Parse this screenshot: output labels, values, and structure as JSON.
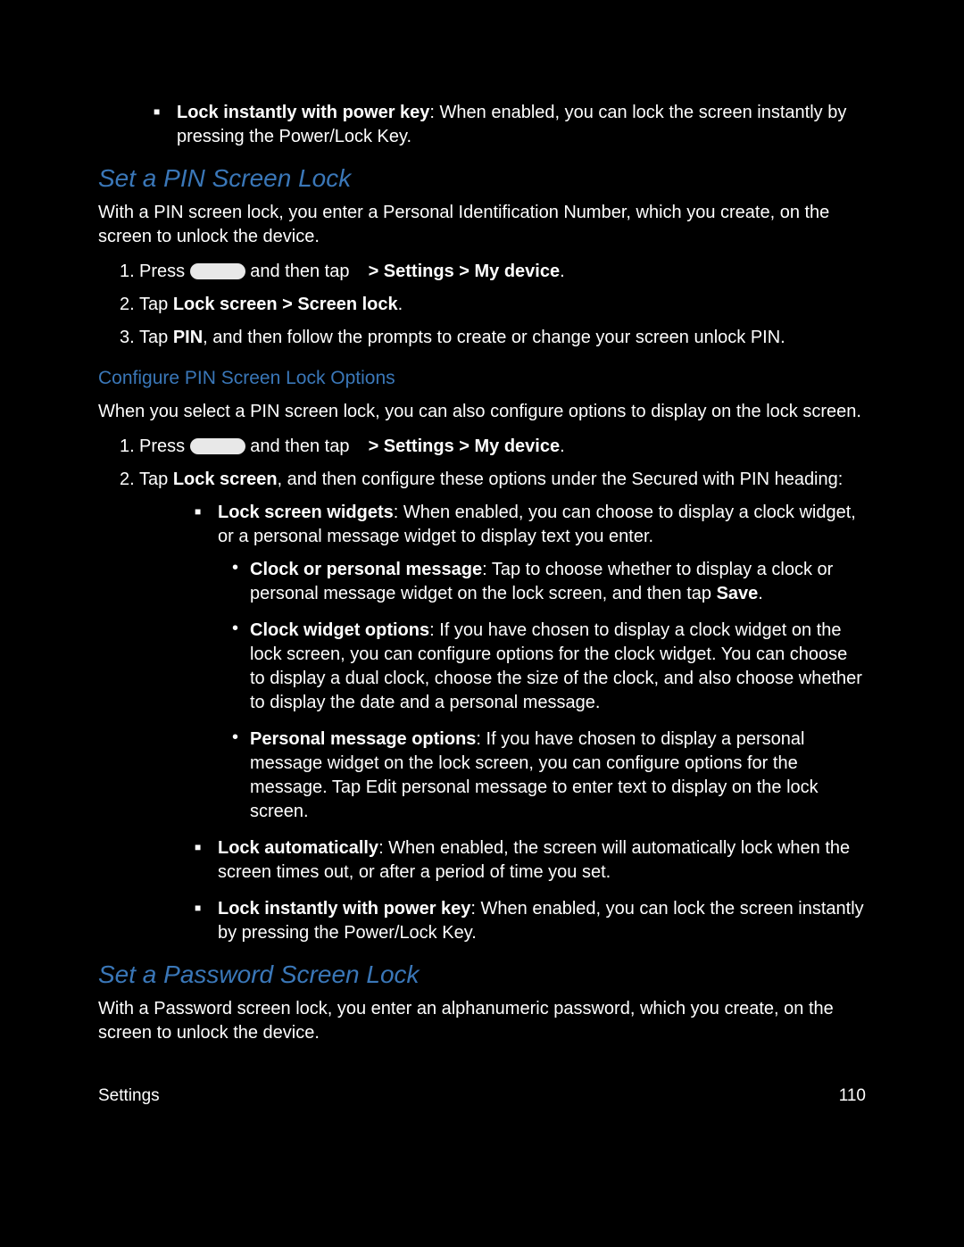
{
  "top": {
    "lock_instantly_bold": "Lock instantly with power key",
    "lock_instantly_rest": ": When enabled, you can lock the screen instantly by pressing the Power/Lock Key."
  },
  "pin": {
    "heading": "Set a PIN Screen Lock",
    "intro": "With a PIN screen lock, you enter a Personal Identification Number, which you create, on the screen to unlock the device.",
    "step1_a": "Press ",
    "step1_b": " and then tap ",
    "step1_bold": " > Settings > My device",
    "step1_end": ".",
    "step2_a": "Tap ",
    "step2_bold": "Lock screen > Screen lock",
    "step2_end": ".",
    "step3_a": "Tap ",
    "step3_bold": "PIN",
    "step3_rest": ", and then follow the prompts to create or change your screen unlock PIN."
  },
  "configure": {
    "heading": "Configure PIN Screen Lock Options",
    "intro": "When you select a PIN screen lock, you can also configure options to display on the lock screen.",
    "step1_a": "Press ",
    "step1_b": " and then tap ",
    "step1_bold": " > Settings > My device",
    "step1_end": ".",
    "step2_a": "Tap ",
    "step2_bold": "Lock screen",
    "step2_rest": ", and then configure these options under the Secured with PIN heading:",
    "opt_widgets_bold": "Lock screen widgets",
    "opt_widgets_rest": ": When enabled, you can choose to display a clock widget, or a personal message widget to display text you enter.",
    "sub_clockmsg_bold": "Clock or personal message",
    "sub_clockmsg_rest_a": ": Tap to choose whether to display a clock or personal message widget on the lock screen, and then tap ",
    "sub_clockmsg_save": "Save",
    "sub_clockmsg_end": ".",
    "sub_clockopt_bold": "Clock widget options",
    "sub_clockopt_rest": ": If you have chosen to display a clock widget on the lock screen, you can configure options for the clock widget. You can choose to display a dual clock, choose the size of the clock, and also choose whether to display the date and a personal message.",
    "sub_personal_bold": "Personal message options",
    "sub_personal_rest": ": If you have chosen to display a personal message widget on the lock screen, you can configure options for the message. Tap Edit personal message to enter text to display on the lock screen.",
    "opt_auto_bold": "Lock automatically",
    "opt_auto_rest": ": When enabled, the screen will automatically lock when the screen times out, or after a period of time you set.",
    "opt_power_bold": "Lock instantly with power key",
    "opt_power_rest": ": When enabled, you can lock the screen instantly by pressing the Power/Lock Key."
  },
  "password": {
    "heading": "Set a Password Screen Lock",
    "intro": "With a Password screen lock, you enter an alphanumeric password, which you create, on the screen to unlock the device."
  },
  "footer": {
    "left": "Settings",
    "right": "110"
  }
}
